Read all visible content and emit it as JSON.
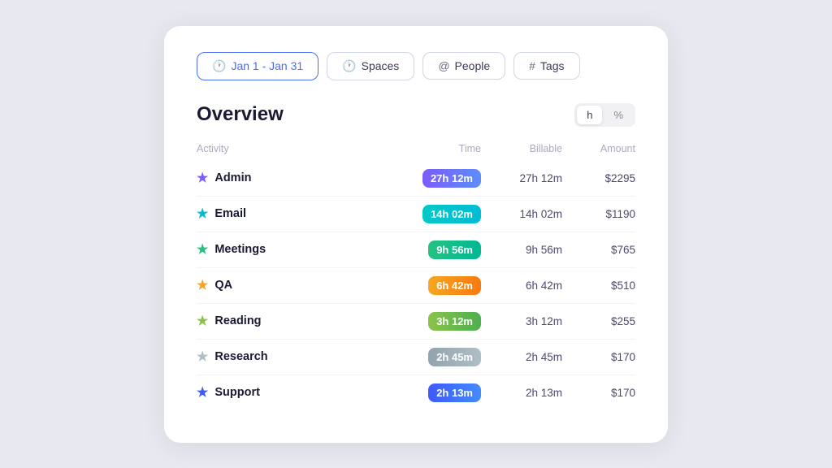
{
  "filters": [
    {
      "id": "date",
      "label": "Jan 1 - Jan 31",
      "icon": "🕐",
      "active": true
    },
    {
      "id": "spaces",
      "label": "Spaces",
      "icon": "🕐",
      "active": false
    },
    {
      "id": "people",
      "label": "People",
      "icon": "@",
      "active": false
    },
    {
      "id": "tags",
      "label": "Tags",
      "icon": "#",
      "active": false
    }
  ],
  "overview": {
    "title": "Overview",
    "toggle": {
      "options": [
        "h",
        "%"
      ],
      "active": "h"
    }
  },
  "table": {
    "headers": [
      "Activity",
      "Time",
      "Billable",
      "Amount"
    ],
    "rows": [
      {
        "name": "Admin",
        "starColor": "#7c5cfc",
        "badgeColor": "linear-gradient(90deg,#7c5cfc,#5c8dfc)",
        "time": "27h 12m",
        "billable": "27h 12m",
        "amount": "$2295"
      },
      {
        "name": "Email",
        "starColor": "#00bcd4",
        "badgeColor": "linear-gradient(90deg,#00c9c9,#00bcd4)",
        "time": "14h 02m",
        "billable": "14h 02m",
        "amount": "$1190"
      },
      {
        "name": "Meetings",
        "starColor": "#26c281",
        "badgeColor": "linear-gradient(90deg,#26c281,#00b894)",
        "time": "9h 56m",
        "billable": "9h 56m",
        "amount": "$765"
      },
      {
        "name": "QA",
        "starColor": "#f5a623",
        "badgeColor": "linear-gradient(90deg,#f5a623,#f9790e)",
        "time": "6h 42m",
        "billable": "6h 42m",
        "amount": "$510"
      },
      {
        "name": "Reading",
        "starColor": "#8bc34a",
        "badgeColor": "linear-gradient(90deg,#8bc34a,#4caf50)",
        "time": "3h 12m",
        "billable": "3h 12m",
        "amount": "$255"
      },
      {
        "name": "Research",
        "starColor": "#b0bec5",
        "badgeColor": "linear-gradient(90deg,#90a4ae,#b0bec5)",
        "time": "2h 45m",
        "billable": "2h 45m",
        "amount": "$170"
      },
      {
        "name": "Support",
        "starColor": "#3d5afe",
        "badgeColor": "linear-gradient(90deg,#3d5afe,#448aff)",
        "time": "2h 13m",
        "billable": "2h 13m",
        "amount": "$170"
      }
    ]
  }
}
